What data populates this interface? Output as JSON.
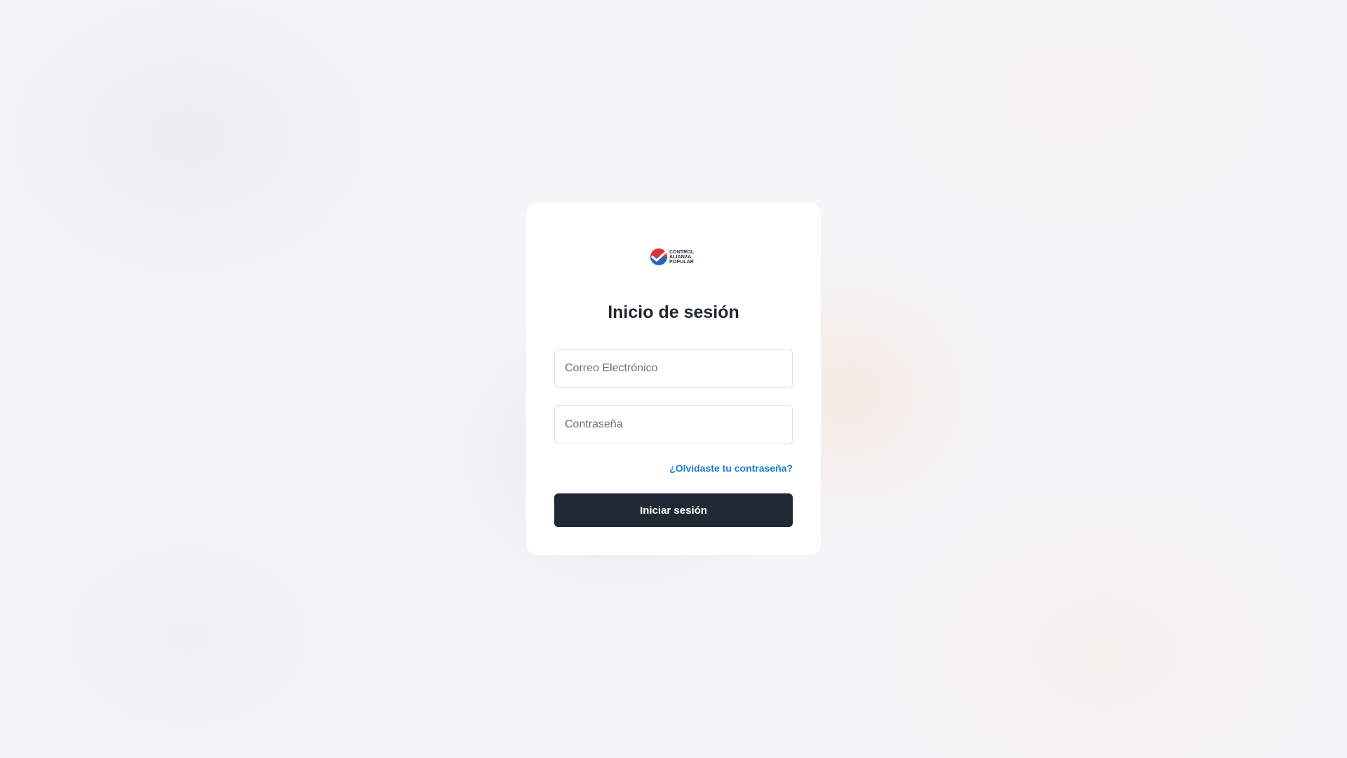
{
  "brand": {
    "logo_lines": [
      "CONTROL",
      "ALIANZA",
      "POPULAR"
    ],
    "logo_icon": "checkmark-circle-icon",
    "colors": {
      "red": "#e0343b",
      "blue": "#2a63b8"
    }
  },
  "login": {
    "title": "Inicio de sesión",
    "email_placeholder": "Correo Electrónico",
    "email_value": "",
    "password_placeholder": "Contraseña",
    "password_value": "",
    "forgot_label": "¿Olvidaste tu contraseña?",
    "submit_label": "Iniciar sesión"
  },
  "theme": {
    "accent": "#1c7bd4",
    "button_bg": "#212a34"
  }
}
